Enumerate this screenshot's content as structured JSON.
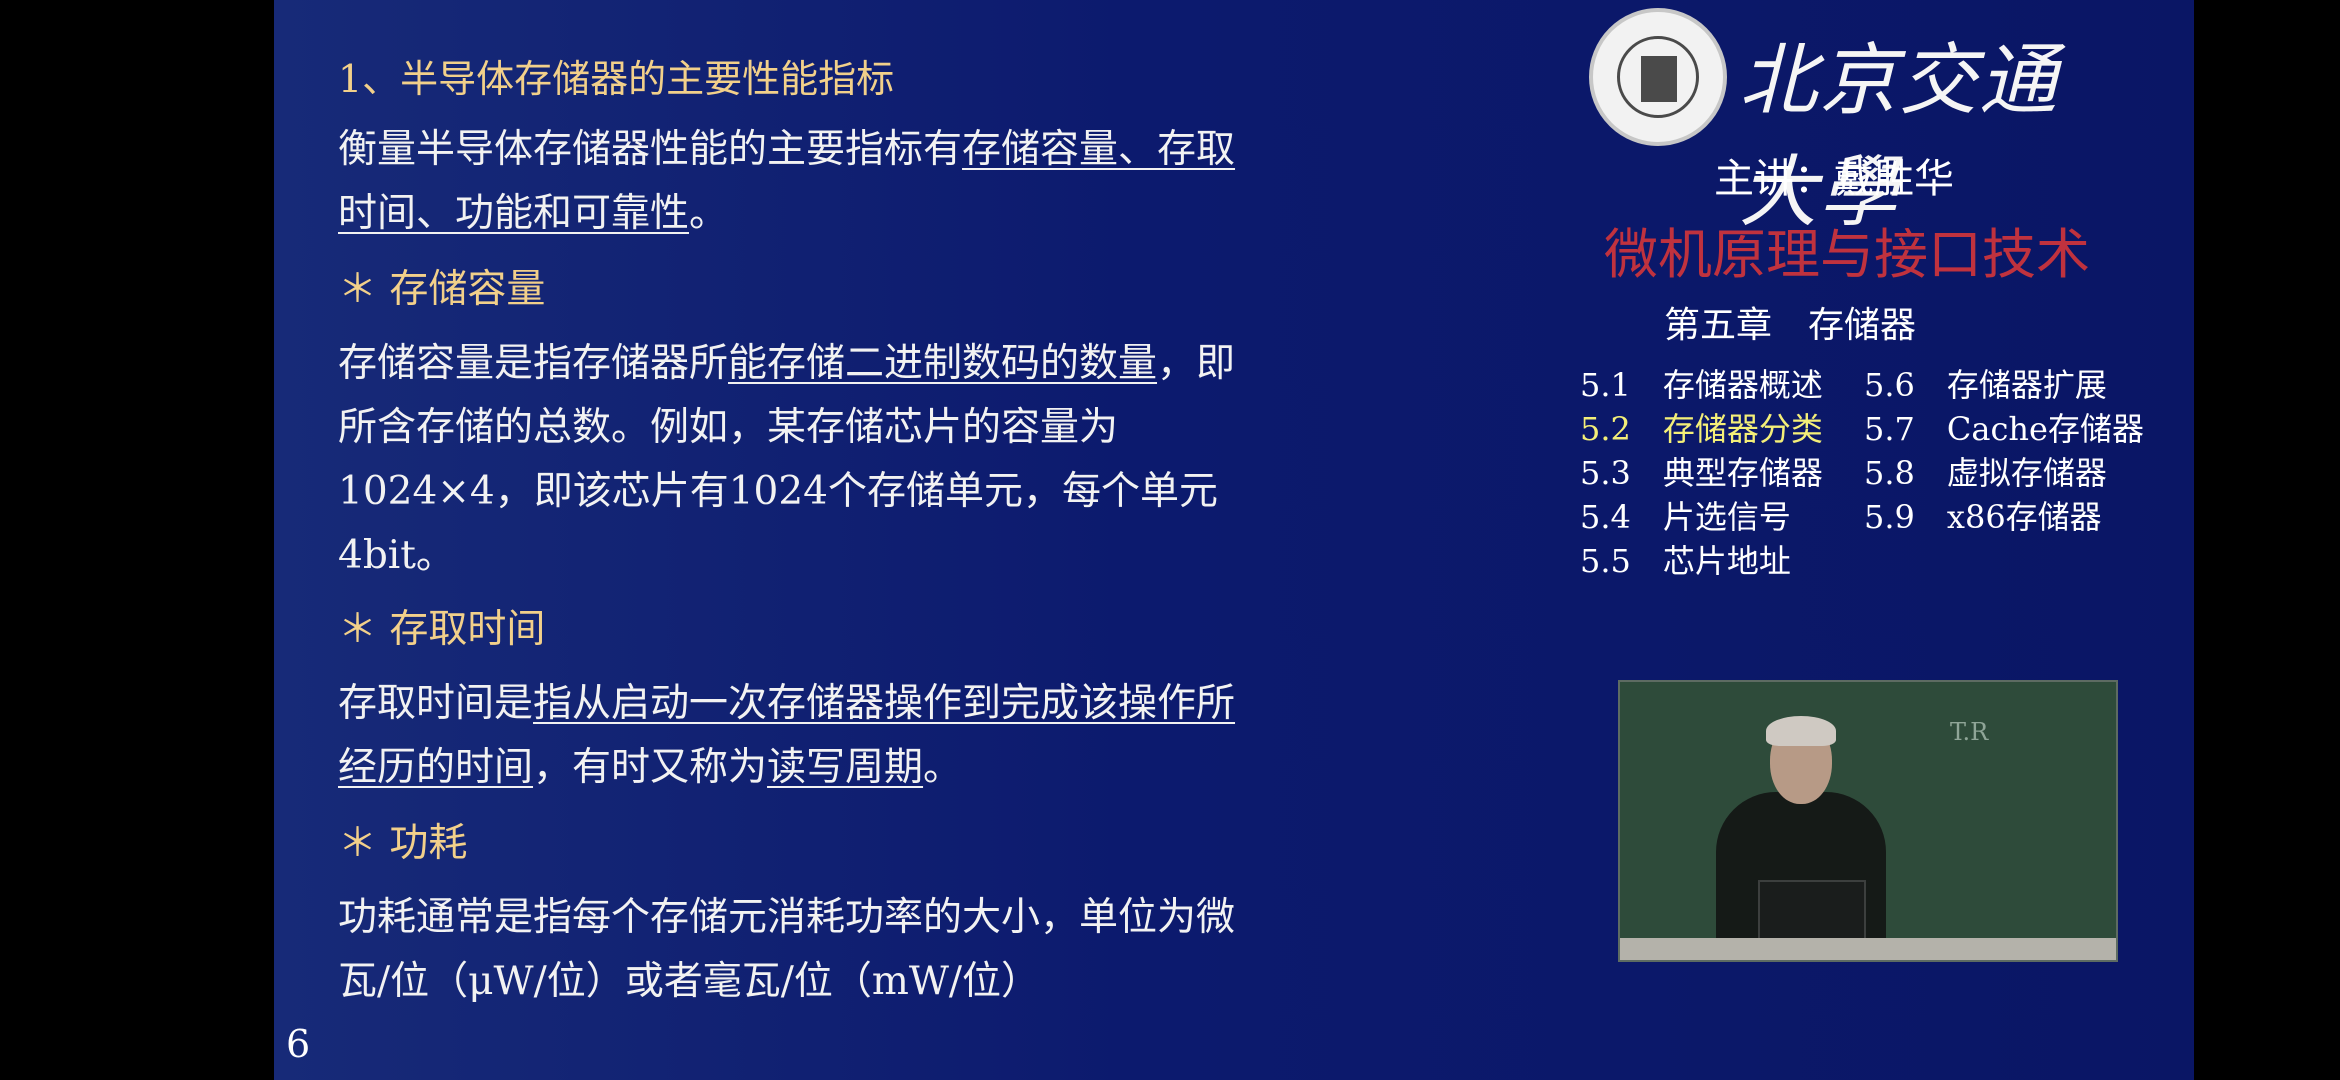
{
  "slide": {
    "section_title": "1、半导体存储器的主要性能指标",
    "intro": {
      "line1_plain": "衡量半导体存储器性能的主要指标有",
      "line1_underlined": "存储容量、存取",
      "line2_underlined": "时间、功能和可靠性",
      "line2_end": "。"
    },
    "capacity": {
      "heading": "＊ 存储容量",
      "line1_start": "存储容量是指存储器所",
      "line1_underlined": "能存储二进制数码的数量",
      "line1_end": "，即",
      "line2": "所含存储的总数。例如，某存储芯片的容量为",
      "line3": "1024×4，即该芯片有1024个存储单元，每个单元",
      "line4": "4bit。"
    },
    "access": {
      "heading": "＊ 存取时间",
      "line1_start": "存取时间是",
      "line1_underlined": "指从启动一次存储器操作到完成该操作所",
      "line2_underlined": "经历的时间",
      "line2_mid": "，有时又称为",
      "line2_underlined2": "读写周期",
      "line2_end": "。"
    },
    "power": {
      "heading": "＊ 功耗",
      "line1": "功耗通常是指每个存储元消耗功率的大小，单位为微",
      "line2": "瓦/位（μW/位）或者毫瓦/位（mW/位）"
    },
    "page_number": "6"
  },
  "sidebar": {
    "university": "北京交通大學",
    "lecturer": "主讲：戴胜华",
    "course": "微机原理与接口技术",
    "chapter": "第五章　存储器",
    "toc_left": [
      {
        "num": "5.1",
        "label": "存储器概述"
      },
      {
        "num": "5.2",
        "label": "存储器分类"
      },
      {
        "num": "5.3",
        "label": "典型存储器"
      },
      {
        "num": "5.4",
        "label": "片选信号"
      },
      {
        "num": "5.5",
        "label": "芯片地址"
      }
    ],
    "toc_right": [
      {
        "num": "5.6",
        "label": "存储器扩展"
      },
      {
        "num": "5.7",
        "label": "Cache存储器"
      },
      {
        "num": "5.8",
        "label": "虚拟存储器"
      },
      {
        "num": "5.9",
        "label": "x86存储器"
      }
    ],
    "active_item": "5.2",
    "active_color": "#f4ef78",
    "course_color": "#c0323e"
  },
  "video": {
    "board_text": "T.R"
  }
}
